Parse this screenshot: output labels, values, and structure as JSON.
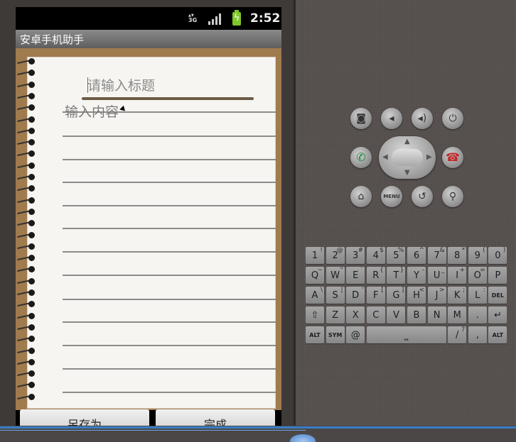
{
  "status_bar": {
    "network_type": "3G",
    "time": "2:52",
    "battery_level": 1.0,
    "signal_bars": 4
  },
  "app": {
    "title": "安卓手机助手"
  },
  "note": {
    "title_placeholder": "请输入标题",
    "content_placeholder": "输入内容"
  },
  "buttons": {
    "save_as": "另存为",
    "done": "完成"
  },
  "emulator_controls": {
    "menu_label": "MENU"
  },
  "keyboard": {
    "rows": [
      [
        {
          "k": "1",
          "a": "!"
        },
        {
          "k": "2",
          "a": "@"
        },
        {
          "k": "3",
          "a": "#"
        },
        {
          "k": "4",
          "a": "$"
        },
        {
          "k": "5",
          "a": "%"
        },
        {
          "k": "6",
          "a": "^"
        },
        {
          "k": "7",
          "a": "&"
        },
        {
          "k": "8",
          "a": "*"
        },
        {
          "k": "9",
          "a": "("
        },
        {
          "k": "0",
          "a": ")"
        }
      ],
      [
        {
          "k": "Q",
          "a": "~"
        },
        {
          "k": "W",
          "a": "\""
        },
        {
          "k": "E",
          "a": "`"
        },
        {
          "k": "R",
          "a": "{"
        },
        {
          "k": "T",
          "a": "}"
        },
        {
          "k": "Y",
          "a": "-"
        },
        {
          "k": "U",
          "a": "_"
        },
        {
          "k": "I",
          "a": "+"
        },
        {
          "k": "O",
          "a": "="
        },
        {
          "k": "P",
          "a": ""
        }
      ],
      [
        {
          "k": "A",
          "a": "\\"
        },
        {
          "k": "S",
          "a": "|"
        },
        {
          "k": "D",
          "a": "'"
        },
        {
          "k": "F",
          "a": "["
        },
        {
          "k": "G",
          "a": "]"
        },
        {
          "k": "H",
          "a": "<"
        },
        {
          "k": "J",
          "a": ">"
        },
        {
          "k": "K",
          "a": ";"
        },
        {
          "k": "L",
          "a": ":"
        }
      ],
      [
        {
          "k": "Z",
          "a": ""
        },
        {
          "k": "X",
          "a": ""
        },
        {
          "k": "C",
          "a": ""
        },
        {
          "k": "V",
          "a": ""
        },
        {
          "k": "B",
          "a": ""
        },
        {
          "k": "N",
          "a": ""
        },
        {
          "k": "M",
          "a": ""
        },
        {
          "k": ".",
          "a": ""
        }
      ],
      [
        {
          "k": "ALT",
          "a": ""
        },
        {
          "k": "SYM",
          "a": ""
        },
        {
          "k": "@",
          "a": ""
        },
        {
          "k": "/",
          "a": "?"
        },
        {
          "k": ",",
          "a": ""
        },
        {
          "k": "ALT",
          "a": ""
        }
      ]
    ],
    "del_label": "DEL"
  }
}
